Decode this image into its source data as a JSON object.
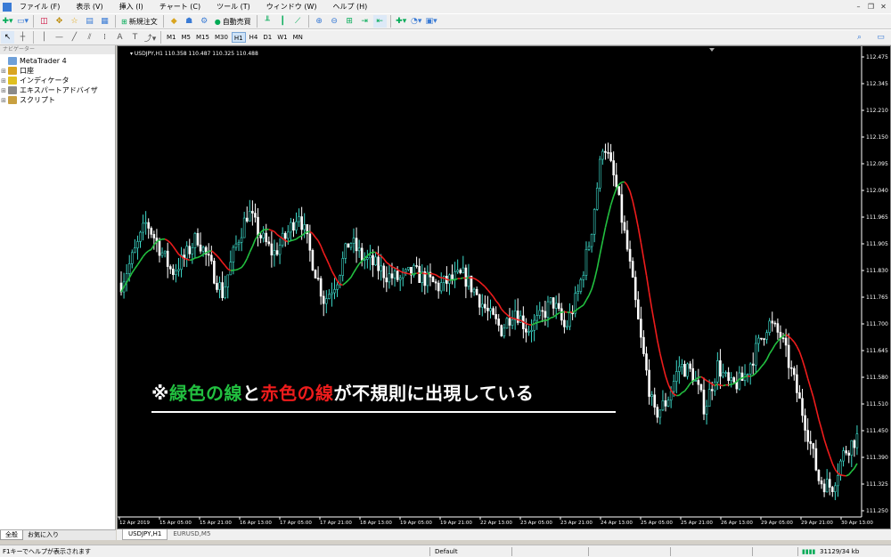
{
  "menu": {
    "items": [
      "ファイル (F)",
      "表示 (V)",
      "挿入 (I)",
      "チャート (C)",
      "ツール (T)",
      "ウィンドウ (W)",
      "ヘルプ (H)"
    ]
  },
  "toolbar": {
    "new_order_label": "新規注文",
    "autotrade_label": "自動売買"
  },
  "timeframes": [
    "M1",
    "M5",
    "M15",
    "M30",
    "H1",
    "H4",
    "D1",
    "W1",
    "MN"
  ],
  "active_timeframe": "H1",
  "navigator": {
    "title": "ナビゲーター",
    "items": [
      {
        "label": "MetaTrader 4",
        "icon": "app-icon",
        "color": "#6fa0d8"
      },
      {
        "label": "口座",
        "icon": "accounts-icon",
        "color": "#d9a520"
      },
      {
        "label": "インディケータ",
        "icon": "indicators-icon",
        "color": "#e0c020"
      },
      {
        "label": "エキスパートアドバイザ",
        "icon": "expert-advisors-icon",
        "color": "#8a8a8a"
      },
      {
        "label": "スクリプト",
        "icon": "scripts-icon",
        "color": "#c8a040"
      }
    ],
    "tabs": [
      "全般",
      "お気に入り"
    ]
  },
  "chart_header": {
    "symbol": "USDJPY,H1",
    "ohlc": "110.358 110.487 110.325 110.488"
  },
  "annotation": {
    "prefix": "※",
    "green_text": "緑色の線",
    "and_text": "と",
    "red_text": "赤色の線",
    "suffix": "が不規則に出現している",
    "colors": {
      "green": "#22c040",
      "red": "#ee1c1c",
      "white": "#ffffff"
    }
  },
  "chart_tabs": [
    "USDJPY,H1",
    "EURUSD,M5"
  ],
  "status": {
    "help": "F1キーでヘルプが表示されます",
    "profile": "Default",
    "traffic": "31129/34 kb"
  },
  "chart_data": {
    "type": "candlestick",
    "symbol": "USDJPY",
    "timeframe": "H1",
    "ylim": [
      111.2,
      112.5
    ],
    "y_ticks": [
      "112.475",
      "112.345",
      "112.210",
      "112.150",
      "112.095",
      "112.040",
      "111.965",
      "111.905",
      "111.830",
      "111.765",
      "111.700",
      "111.645",
      "111.580",
      "111.510",
      "111.450",
      "111.390",
      "111.325",
      "111.250"
    ],
    "x_ticks": [
      "12 Apr 2019",
      "15 Apr 05:00",
      "15 Apr 21:00",
      "16 Apr 13:00",
      "17 Apr 05:00",
      "17 Apr 21:00",
      "18 Apr 13:00",
      "19 Apr 05:00",
      "19 Apr 21:00",
      "22 Apr 13:00",
      "23 Apr 05:00",
      "23 Apr 21:00",
      "24 Apr 13:00",
      "25 Apr 05:00",
      "25 Apr 21:00",
      "26 Apr 13:00",
      "29 Apr 05:00",
      "29 Apr 21:00",
      "30 Apr 13:00"
    ],
    "price_path": [
      111.85,
      111.93,
      112.02,
      111.95,
      111.88,
      111.92,
      111.98,
      111.9,
      111.82,
      111.95,
      112.05,
      111.98,
      111.93,
      111.98,
      112.05,
      111.92,
      111.8,
      111.86,
      111.97,
      111.92,
      111.9,
      111.87,
      111.86,
      111.88,
      111.86,
      111.84,
      111.86,
      111.87,
      111.82,
      111.76,
      111.72,
      111.78,
      111.72,
      111.75,
      111.8,
      111.72,
      111.82,
      111.98,
      112.25,
      112.12,
      111.92,
      111.68,
      111.48,
      111.52,
      111.62,
      111.6,
      111.5,
      111.62,
      111.56,
      111.58,
      111.66,
      111.74,
      111.7,
      111.58,
      111.45,
      111.3,
      111.28,
      111.38,
      111.42
    ]
  }
}
